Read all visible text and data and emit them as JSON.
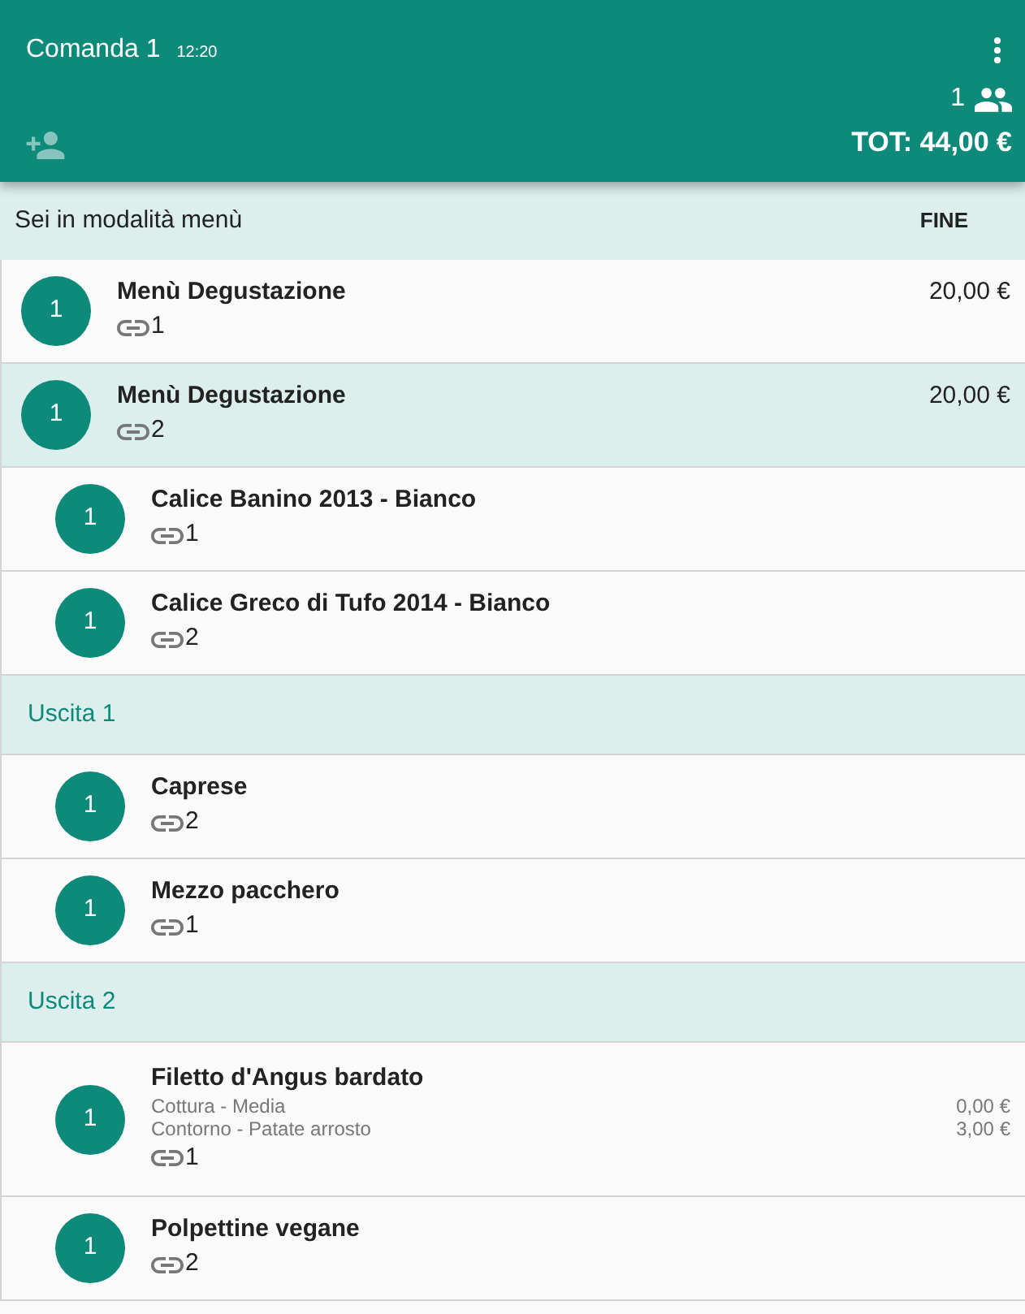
{
  "header": {
    "title": "Comanda 1",
    "time": "12:20",
    "guests": "1",
    "total": "TOT: 44,00 €",
    "add_guest": {
      "disabled": true
    }
  },
  "mode_bar": {
    "message": "Sei in modalità menù",
    "action": "FINE"
  },
  "orders": [
    {
      "kind": "menu",
      "quantity": "1",
      "name": "Menù Degustazione",
      "link": "1",
      "price": "20,00 €",
      "selected": false
    },
    {
      "kind": "menu",
      "quantity": "1",
      "name": "Menù Degustazione",
      "link": "2",
      "price": "20,00 €",
      "selected": true,
      "children": [
        {
          "kind": "item",
          "quantity": "1",
          "name": "Calice Banino 2013 - Bianco",
          "link": "1",
          "selected": false
        },
        {
          "kind": "item",
          "quantity": "1",
          "name": "Calice Greco di Tufo 2014 - Bianco",
          "link": "2",
          "selected": false
        },
        {
          "kind": "course",
          "label": "Uscita 1",
          "children": [
            {
              "kind": "item",
              "quantity": "1",
              "name": "Caprese",
              "link": "2",
              "selected": false
            },
            {
              "kind": "item",
              "quantity": "1",
              "name": "Mezzo pacchero",
              "link": "1",
              "selected": false
            }
          ]
        },
        {
          "kind": "course",
          "label": "Uscita 2",
          "children": [
            {
              "kind": "item",
              "quantity": "1",
              "name": "Filetto d'Angus bardato",
              "modifiers": [
                {
                  "text": "Cottura - Media",
                  "price": "0,00 €"
                },
                {
                  "text": "Contorno - Patate arrosto",
                  "price": "3,00 €"
                }
              ],
              "link": "1",
              "selected": false
            },
            {
              "kind": "item",
              "quantity": "1",
              "name": "Polpettine vegane",
              "link": "2",
              "selected": false
            }
          ]
        }
      ]
    }
  ]
}
